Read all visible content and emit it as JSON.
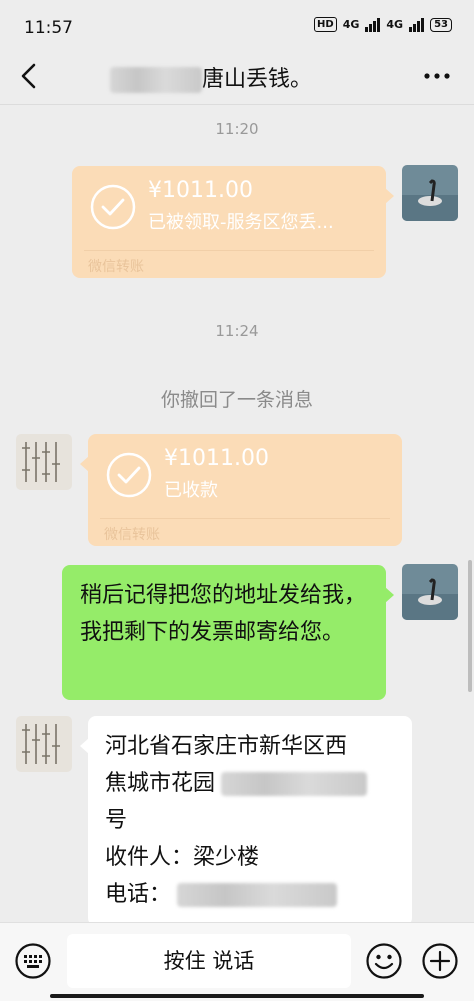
{
  "status_bar": {
    "time": "11:57",
    "hd_label": "HD",
    "network_1": "4G",
    "network_2": "4G",
    "battery": "53"
  },
  "header": {
    "title_visible": "唐山丢钱。",
    "back_icon": "chevron-left-icon",
    "more_icon": "ellipsis-icon"
  },
  "messages": {
    "time_1": "11:20",
    "transfer_sent": {
      "amount": "¥1011.00",
      "status": "已被领取-服务区您丢...",
      "footer": "微信转账"
    },
    "time_2": "11:24",
    "recall_notice": "你撤回了一条消息",
    "transfer_received": {
      "amount": "¥1011.00",
      "status": "已收款",
      "footer": "微信转账"
    },
    "sent_text": "稍后记得把您的地址发给我，我把剩下的发票邮寄给您。",
    "received_address": {
      "line1": "河北省石家庄市新华区西",
      "line2_prefix": "焦城市花园",
      "line3": "号",
      "line4": "收件人：梁少楼",
      "line5_prefix": "电话："
    }
  },
  "input_bar": {
    "voice_icon": "keyboard-icon",
    "hold_to_talk": "按住 说话",
    "emoji_icon": "smiley-icon",
    "plus_icon": "plus-icon"
  },
  "colors": {
    "background": "#ededed",
    "transfer_bubble": "#fbdcb7",
    "sent_bubble": "#95ec69",
    "received_bubble": "#ffffff"
  }
}
